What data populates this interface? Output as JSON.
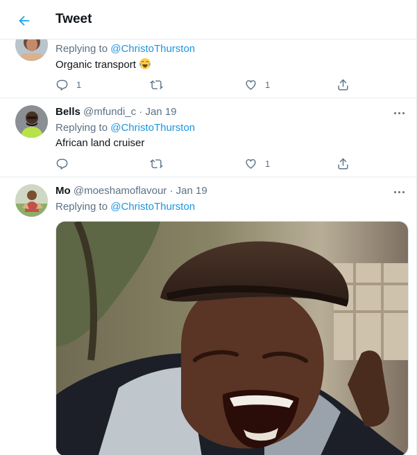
{
  "header": {
    "title": "Tweet"
  },
  "tweets": [
    {
      "replying_prefix": "Replying to",
      "replying_to": "@ChristoThurston",
      "text": "Organic transport",
      "emoji": "face-with-tears-of-joy",
      "reply_count": "1",
      "retweet_count": "",
      "like_count": "1"
    },
    {
      "name": "Bells",
      "handle": "@mfundi_c",
      "date": "Jan 19",
      "replying_prefix": "Replying to",
      "replying_to": "@ChristoThurston",
      "text": "African land cruiser",
      "reply_count": "",
      "retweet_count": "",
      "like_count": "1"
    },
    {
      "name": "Mo",
      "handle": "@moeshamoflavour",
      "date": "Jan 19",
      "replying_prefix": "Replying to",
      "replying_to": "@ChristoThurston",
      "media": "laughing-man-gif"
    }
  ],
  "colors": {
    "accent": "#1b95e0",
    "muted": "#5b7083",
    "border": "#e6ecf0"
  },
  "icons": [
    "back-arrow-icon",
    "reply-icon",
    "retweet-icon",
    "like-icon",
    "share-icon",
    "more-icon"
  ]
}
